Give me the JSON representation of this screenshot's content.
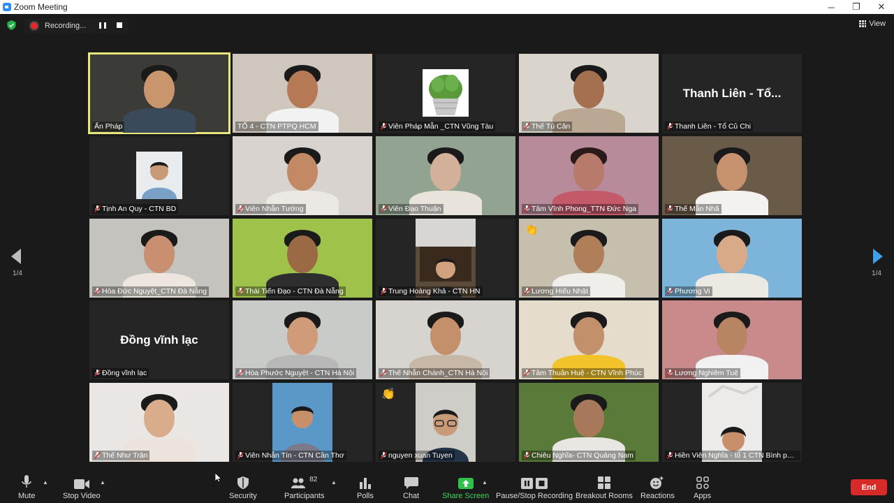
{
  "window": {
    "title": "Zoom Meeting",
    "minimize": "─",
    "maximize": "❐",
    "close": "✕"
  },
  "recording": {
    "label": "Recording..."
  },
  "view": {
    "label": "View"
  },
  "pagination": {
    "prev_page": "1/4",
    "next_page": "1/4"
  },
  "participants": [
    {
      "name": "Ẩn Pháp",
      "muted": false,
      "active": true,
      "bg": "#3b3b37",
      "skin": "#c9956c",
      "shirt": "#3a4a5a",
      "hair": "#1a1a1a"
    },
    {
      "name": "TỔ 4 - CTN PTPQ HCM",
      "muted": false,
      "bg": "#cfc6bd",
      "skin": "#b57a55",
      "shirt": "#f2f2f2",
      "hair": "#1a1a1a"
    },
    {
      "name": "Viên Pháp Mẫn _CTN Vũng Tàu",
      "muted": true,
      "bg": "#252525",
      "image": "cactus"
    },
    {
      "name": "Thế Tú Căn",
      "muted": true,
      "bg": "#d9d4cc",
      "skin": "#a5704f",
      "shirt": "#bba892",
      "hair": "#1a1a1a"
    },
    {
      "name": "Thanh Liên - Tổ Củ Chi",
      "muted": true,
      "bg": "#252525",
      "big": "Thanh Liên - Tổ..."
    },
    {
      "name": "Tịnh An Quy - CTN BD",
      "muted": true,
      "bg": "#252525",
      "image": "portrait"
    },
    {
      "name": "Viên Nhẫn Tướng",
      "muted": true,
      "bg": "#d8d3ce",
      "skin": "#c28a64",
      "shirt": "#ece8e3",
      "hair": "#1a1a1a"
    },
    {
      "name": "Viên Đạo Thuận",
      "muted": true,
      "bg": "#93a391",
      "skin": "#d3b09a",
      "shirt": "#e8e4dc",
      "hair": "#1a1a1a"
    },
    {
      "name": "Tâm Vĩnh Phong_TTN Đức Nga",
      "muted": true,
      "bg": "#b88b9a",
      "skin": "#b87a6b",
      "shirt": "#c4596a",
      "hair": "#2a1a1a"
    },
    {
      "name": "Thế Mẫn Nhã",
      "muted": true,
      "bg": "#6a5a48",
      "skin": "#c7936e",
      "shirt": "#f4f2ef",
      "hair": "#1a1a1a"
    },
    {
      "name": "Hòa Đức Nguyệt_CTN Đà Nẵng",
      "muted": true,
      "bg": "#c5c3bd",
      "skin": "#c89070",
      "shirt": "#ece6de",
      "hair": "#1a1a1a"
    },
    {
      "name": "Thái Tiến Đạo - CTN Đà Nẵng",
      "muted": true,
      "bg": "#9fc24a",
      "skin": "#9b6a45",
      "shirt": "#2e2e2e",
      "hair": "#1a1a1a"
    },
    {
      "name": "Trung Hoàng Khả - CTN HN",
      "muted": true,
      "bg": "#252525",
      "image": "dark-room"
    },
    {
      "name": "Lương Hiếu Nhật",
      "muted": true,
      "bg": "#c7bfae",
      "skin": "#b07e58",
      "shirt": "#f0eeea",
      "hair": "#1a1a1a",
      "reaction": "👏"
    },
    {
      "name": "Phương Vi",
      "muted": true,
      "bg": "#7db5da",
      "skin": "#d8aa88",
      "shirt": "#ece8e2",
      "hair": "#1a1a1a"
    },
    {
      "name": "Đồng vĩnh lạc",
      "muted": true,
      "bg": "#252525",
      "big": "Đồng vĩnh lạc"
    },
    {
      "name": "Hòa Phước Nguyệt - CTN Hà Nội",
      "muted": true,
      "bg": "#c9cbc9",
      "skin": "#cf9b78",
      "shirt": "#b8b8b8",
      "hair": "#1a1a1a"
    },
    {
      "name": "Thế Nhẫn Chánh_CTN Hà Nội",
      "muted": true,
      "bg": "#d7d3ce",
      "skin": "#c4906c",
      "shirt": "#c6b7a6",
      "hair": "#1a1a1a"
    },
    {
      "name": "Tâm Thuần Huệ - CTN Vĩnh Phúc",
      "muted": true,
      "bg": "#e6dccb",
      "skin": "#c2906a",
      "shirt": "#f2c32a",
      "hair": "#1a1a1a"
    },
    {
      "name": "Lương Nghiêm Tuệ",
      "muted": true,
      "bg": "#c98a8c",
      "skin": "#b88562",
      "shirt": "#f1f1f1",
      "hair": "#1a1a1a"
    },
    {
      "name": "Thế Như Trân",
      "muted": true,
      "bg": "#e9e6e4",
      "skin": "#d9ad8c",
      "shirt": "#ece4dc",
      "hair": "#1a1a1a"
    },
    {
      "name": "Viên Nhẫn Tín - CTN Cần Thơ",
      "muted": true,
      "bg": "#252525",
      "image": "small-video"
    },
    {
      "name": "nguyen xuan Tuyen",
      "muted": true,
      "bg": "#252525",
      "image": "small-glasses",
      "reaction": "👏"
    },
    {
      "name": "Chiêu Nghĩa- CTN Quảng Nam",
      "muted": true,
      "bg": "#5a7a3a",
      "skin": "#a8785a",
      "shirt": "#e8e6e2",
      "hair": "#1a1a1a"
    },
    {
      "name": "Hiền Viên Nghĩa - tổ 1 CTN Bình phư...",
      "muted": true,
      "bg": "#252525",
      "image": "small-white"
    }
  ],
  "toolbar": {
    "mute": "Mute",
    "stop_video": "Stop Video",
    "security": "Security",
    "participants": "Participants",
    "participant_count": "82",
    "polls": "Polls",
    "chat": "Chat",
    "share_screen": "Share Screen",
    "pause_stop_recording": "Pause/Stop Recording",
    "breakout_rooms": "Breakout Rooms",
    "reactions": "Reactions",
    "apps": "Apps",
    "end": "End"
  },
  "colors": {
    "accent_share": "#40d45a",
    "end": "#d92a2a",
    "active_speaker": "#e8e87a",
    "next_arrow": "#3ea0e8"
  }
}
